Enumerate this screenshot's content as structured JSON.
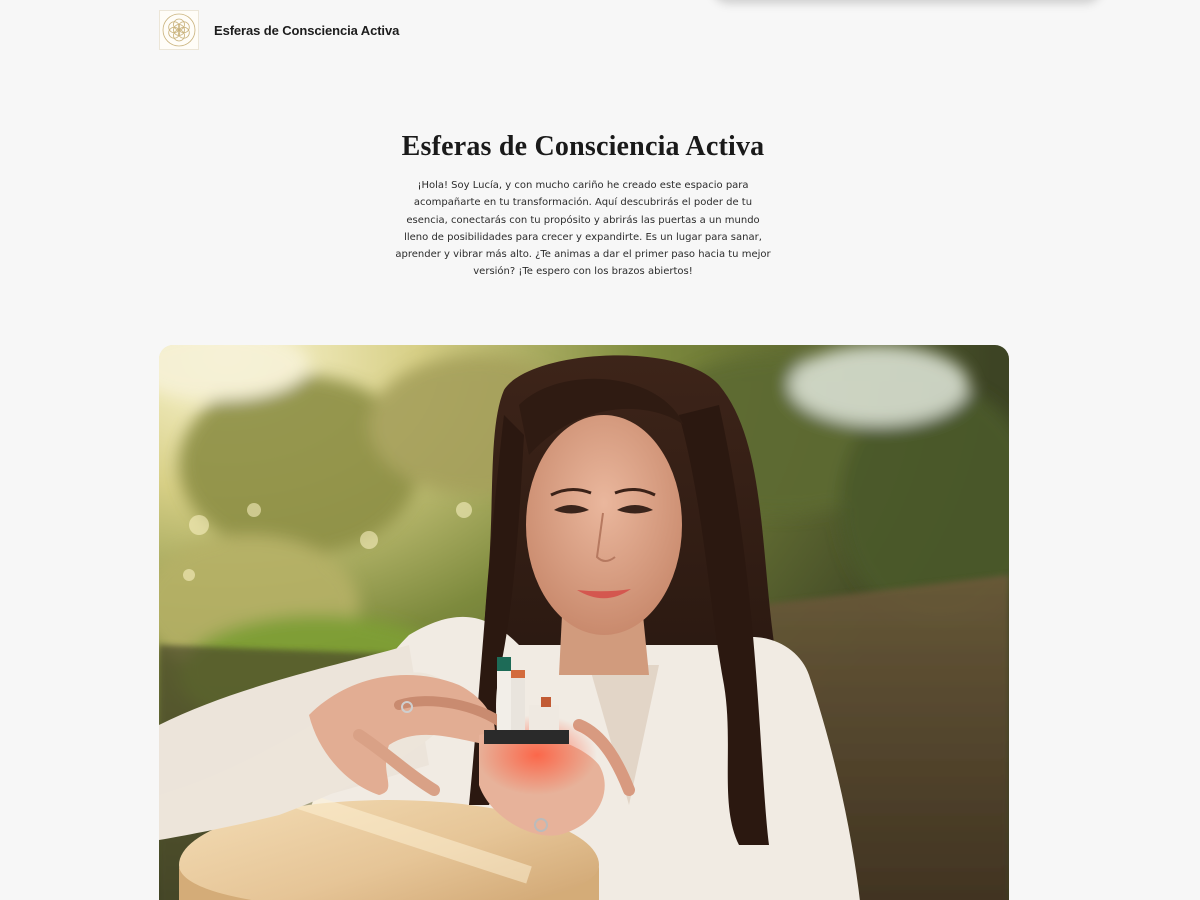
{
  "header": {
    "site_name": "Esferas de Consciencia Activa",
    "logo_icon": "flower-of-life-logo-icon"
  },
  "hero": {
    "title": "Esferas de Consciencia Activa",
    "intro": "¡Hola! Soy Lucía, y con mucho cariño he creado este espacio para acompañarte en tu transformación. Aquí descubrirás el poder de tu esencia, conectarás con tu propósito y abrirás las puertas a un mundo lleno de posibilidades para crecer y expandirte. Es un lugar para sanar, aprender y vibrar más alto. ¿Te animas a dar el primer paso hacia tu mejor versión? ¡Te espero con los brazos abiertos!"
  },
  "photo": {
    "subject": "photo-of-woman-holding-small-figure-outdoors"
  },
  "colors": {
    "page_background": "#f7f7f7",
    "text": "#1f1f1f",
    "logo_gold": "#c9b27c"
  }
}
